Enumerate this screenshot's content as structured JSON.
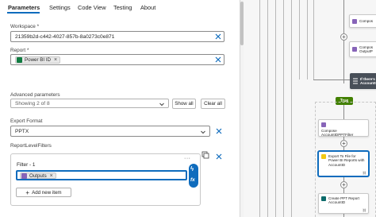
{
  "tabs": [
    {
      "label": "Parameters"
    },
    {
      "label": "Settings"
    },
    {
      "label": "Code View"
    },
    {
      "label": "Testing"
    },
    {
      "label": "About"
    }
  ],
  "workspace": {
    "label": "Workspace *",
    "value": "21359b2d-c442-4027-857b-8a0273c0e871"
  },
  "report": {
    "label": "Report *",
    "token": "Power BI ID"
  },
  "advanced": {
    "label": "Advanced parameters",
    "summary": "Showing 2 of 8",
    "show_all": "Show all",
    "clear_all": "Clear all"
  },
  "export_format": {
    "label": "Export Format",
    "value": "PPTX"
  },
  "report_level_filters": {
    "label": "ReportLevelFilters",
    "item_label": "Filter - 1",
    "token": "Outputs",
    "add_item": "Add new item"
  },
  "canvas": {
    "nodes": [
      {
        "name": "compose-top",
        "text": "Compos"
      },
      {
        "name": "compose-output",
        "text": "Compos\nOutputP"
      },
      {
        "name": "condition",
        "text": "If there's\nAccountI"
      },
      {
        "name": "compose-account-ppt",
        "text": "Compose\nAccountIDPPTFilter"
      },
      {
        "name": "export-to-file",
        "text": "Export To File for\nPower BI Reports with\nAccountID"
      },
      {
        "name": "create-ppt",
        "text": "Create PPT Report\nAccountID"
      }
    ],
    "true_label": "True"
  },
  "colors": {
    "accent": "#0f6cbd",
    "powerbi_green": "#107c41",
    "token_purple": "#8764b8",
    "compose_purple": "#8764b8",
    "export_yellow": "#f2c811",
    "create_teal": "#0b6a6a",
    "true_green": "#428000",
    "condition_dark": "#484f58"
  }
}
